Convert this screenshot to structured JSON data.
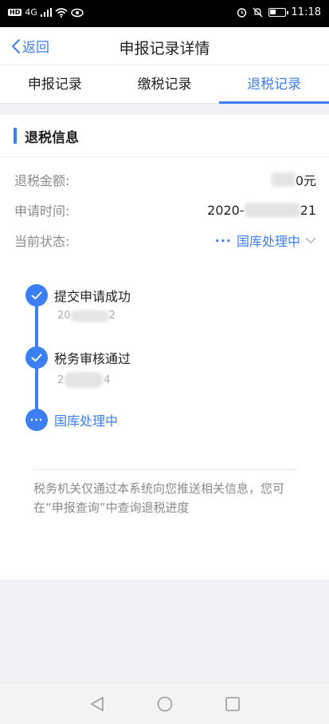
{
  "status_bar": {
    "network": "HD",
    "signal": "4G",
    "time": "11:18",
    "battery_level": 0.4
  },
  "nav": {
    "back_label": "返回",
    "title": "申报记录详情"
  },
  "tabs": [
    {
      "label": "申报记录",
      "active": false
    },
    {
      "label": "缴税记录",
      "active": false
    },
    {
      "label": "退税记录",
      "active": true
    }
  ],
  "section": {
    "title": "退税信息"
  },
  "info": {
    "amount_label": "退税金额:",
    "amount_suffix": "0元",
    "date_label": "申请时间:",
    "date_prefix": "2020-",
    "date_suffix": "21",
    "status_label": "当前状态:",
    "status_value": "国库处理中"
  },
  "timeline": [
    {
      "title": "提交申请成功",
      "date_prefix": "20",
      "date_suffix": "2",
      "state": "done"
    },
    {
      "title": "税务审核通过",
      "date_prefix": "2",
      "date_suffix": "4",
      "state": "done"
    },
    {
      "title": "国库处理中",
      "state": "current"
    }
  ],
  "notice": "税务机关仅通过本系统向您推送相关信息，您可在“申报查询”中查询退税进度",
  "colors": {
    "accent": "#3b7ef5",
    "label_gray": "#8a8a8a",
    "background": "#f1f2f6"
  },
  "icons": [
    "back-chevron-icon",
    "check-icon",
    "more-dots-icon",
    "chevron-down-icon",
    "nav-back-icon",
    "nav-home-icon",
    "nav-recent-icon"
  ]
}
